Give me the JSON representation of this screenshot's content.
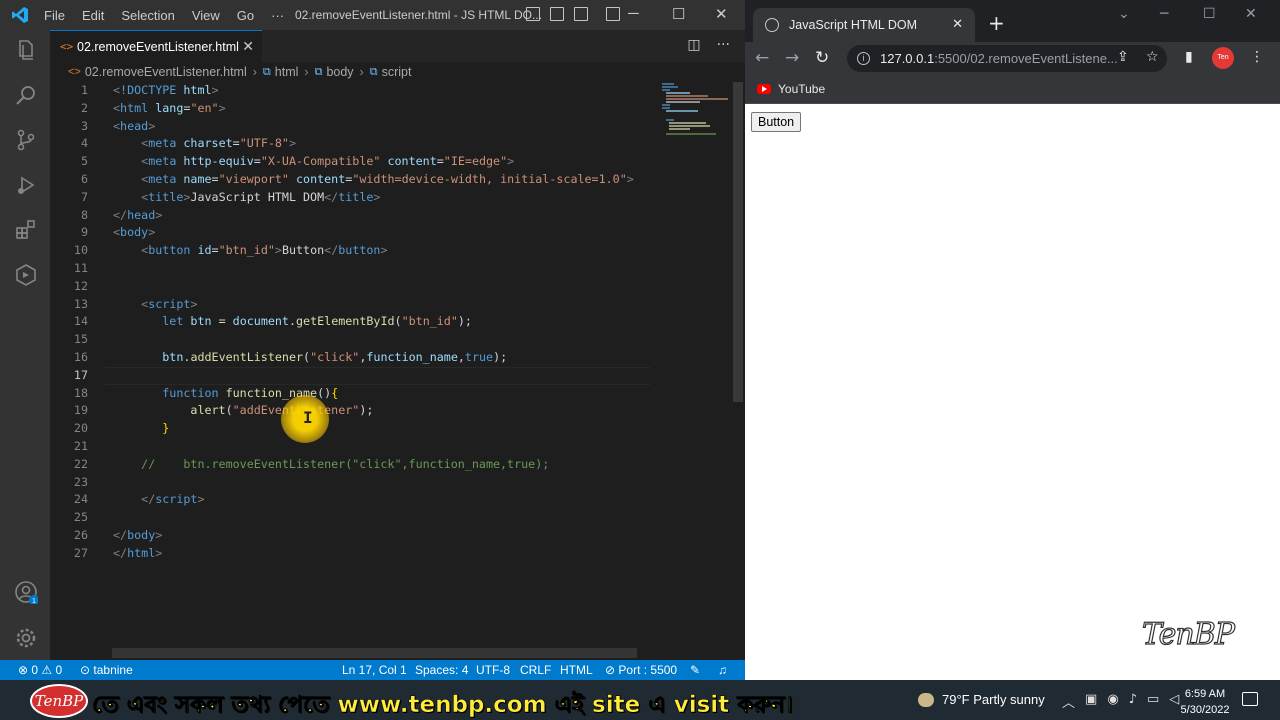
{
  "vscode": {
    "menu": [
      "File",
      "Edit",
      "Selection",
      "View",
      "Go",
      "···"
    ],
    "window_title": "02.removeEventListener.html - JS HTML DO...",
    "tab_label": "02.removeEventListener.html",
    "breadcrumb": [
      "02.removeEventListener.html",
      "html",
      "body",
      "script"
    ],
    "active_line": 17,
    "status": {
      "problems": "⊗ 0 ⚠ 0",
      "tabnine": "tabnine",
      "position": "Ln 17, Col 1",
      "spaces": "Spaces: 4",
      "encoding": "UTF-8",
      "eol": "CRLF",
      "language": "HTML",
      "port": "⊘ Port : 5500"
    },
    "accent": "#007acc"
  },
  "code_lines": [
    {
      "n": "1",
      "indent": "",
      "parts": [
        {
          "c": "t-br",
          "t": "<"
        },
        {
          "c": "t-tag",
          "t": "!DOCTYPE "
        },
        {
          "c": "t-attr",
          "t": "html"
        },
        {
          "c": "t-br",
          "t": ">"
        }
      ]
    },
    {
      "n": "2",
      "indent": "",
      "parts": [
        {
          "c": "t-br",
          "t": "<"
        },
        {
          "c": "t-tag",
          "t": "html "
        },
        {
          "c": "t-attr",
          "t": "lang"
        },
        {
          "c": "t-txt",
          "t": "="
        },
        {
          "c": "t-str",
          "t": "\"en\""
        },
        {
          "c": "t-br",
          "t": ">"
        }
      ]
    },
    {
      "n": "3",
      "indent": "",
      "parts": [
        {
          "c": "t-br",
          "t": "<"
        },
        {
          "c": "t-tag",
          "t": "head"
        },
        {
          "c": "t-br",
          "t": ">"
        }
      ]
    },
    {
      "n": "4",
      "indent": "    ",
      "parts": [
        {
          "c": "t-br",
          "t": "<"
        },
        {
          "c": "t-tag",
          "t": "meta "
        },
        {
          "c": "t-attr",
          "t": "charset"
        },
        {
          "c": "t-txt",
          "t": "="
        },
        {
          "c": "t-str",
          "t": "\"UTF-8\""
        },
        {
          "c": "t-br",
          "t": ">"
        }
      ]
    },
    {
      "n": "5",
      "indent": "    ",
      "parts": [
        {
          "c": "t-br",
          "t": "<"
        },
        {
          "c": "t-tag",
          "t": "meta "
        },
        {
          "c": "t-attr",
          "t": "http-equiv"
        },
        {
          "c": "t-txt",
          "t": "="
        },
        {
          "c": "t-str",
          "t": "\"X-UA-Compatible\" "
        },
        {
          "c": "t-attr",
          "t": "content"
        },
        {
          "c": "t-txt",
          "t": "="
        },
        {
          "c": "t-str",
          "t": "\"IE=edge\""
        },
        {
          "c": "t-br",
          "t": ">"
        }
      ]
    },
    {
      "n": "6",
      "indent": "    ",
      "parts": [
        {
          "c": "t-br",
          "t": "<"
        },
        {
          "c": "t-tag",
          "t": "meta "
        },
        {
          "c": "t-attr",
          "t": "name"
        },
        {
          "c": "t-txt",
          "t": "="
        },
        {
          "c": "t-str",
          "t": "\"viewport\" "
        },
        {
          "c": "t-attr",
          "t": "content"
        },
        {
          "c": "t-txt",
          "t": "="
        },
        {
          "c": "t-str",
          "t": "\"width=device-width, initial-scale=1.0\""
        },
        {
          "c": "t-br",
          "t": ">"
        }
      ]
    },
    {
      "n": "7",
      "indent": "    ",
      "parts": [
        {
          "c": "t-br",
          "t": "<"
        },
        {
          "c": "t-tag",
          "t": "title"
        },
        {
          "c": "t-br",
          "t": ">"
        },
        {
          "c": "t-txt",
          "t": "JavaScript HTML DOM"
        },
        {
          "c": "t-br",
          "t": "</"
        },
        {
          "c": "t-tag",
          "t": "title"
        },
        {
          "c": "t-br",
          "t": ">"
        }
      ]
    },
    {
      "n": "8",
      "indent": "",
      "parts": [
        {
          "c": "t-br",
          "t": "</"
        },
        {
          "c": "t-tag",
          "t": "head"
        },
        {
          "c": "t-br",
          "t": ">"
        }
      ]
    },
    {
      "n": "9",
      "indent": "",
      "parts": [
        {
          "c": "t-br",
          "t": "<"
        },
        {
          "c": "t-tag",
          "t": "body"
        },
        {
          "c": "t-br",
          "t": ">"
        }
      ]
    },
    {
      "n": "10",
      "indent": "    ",
      "parts": [
        {
          "c": "t-br",
          "t": "<"
        },
        {
          "c": "t-tag",
          "t": "button "
        },
        {
          "c": "t-attr",
          "t": "id"
        },
        {
          "c": "t-txt",
          "t": "="
        },
        {
          "c": "t-str",
          "t": "\"btn_id\""
        },
        {
          "c": "t-br",
          "t": ">"
        },
        {
          "c": "t-txt",
          "t": "Button"
        },
        {
          "c": "t-br",
          "t": "</"
        },
        {
          "c": "t-tag",
          "t": "button"
        },
        {
          "c": "t-br",
          "t": ">"
        }
      ]
    },
    {
      "n": "11",
      "indent": "",
      "parts": []
    },
    {
      "n": "12",
      "indent": "",
      "parts": []
    },
    {
      "n": "13",
      "indent": "    ",
      "parts": [
        {
          "c": "t-br",
          "t": "<"
        },
        {
          "c": "t-tag",
          "t": "script"
        },
        {
          "c": "t-br",
          "t": ">"
        }
      ]
    },
    {
      "n": "14",
      "indent": "       ",
      "parts": [
        {
          "c": "t-kw",
          "t": "let "
        },
        {
          "c": "t-var",
          "t": "btn"
        },
        {
          "c": "t-txt",
          "t": " = "
        },
        {
          "c": "t-var",
          "t": "document"
        },
        {
          "c": "t-txt",
          "t": "."
        },
        {
          "c": "t-fn",
          "t": "getElementById"
        },
        {
          "c": "t-txt",
          "t": "("
        },
        {
          "c": "t-str",
          "t": "\"btn_id\""
        },
        {
          "c": "t-txt",
          "t": ");"
        }
      ]
    },
    {
      "n": "15",
      "indent": "",
      "parts": []
    },
    {
      "n": "16",
      "indent": "       ",
      "parts": [
        {
          "c": "t-var",
          "t": "btn"
        },
        {
          "c": "t-txt",
          "t": "."
        },
        {
          "c": "t-fn",
          "t": "addEventListener"
        },
        {
          "c": "t-txt",
          "t": "("
        },
        {
          "c": "t-str",
          "t": "\"click\""
        },
        {
          "c": "t-txt",
          "t": ","
        },
        {
          "c": "t-var",
          "t": "function_name"
        },
        {
          "c": "t-txt",
          "t": ","
        },
        {
          "c": "t-kw",
          "t": "true"
        },
        {
          "c": "t-txt",
          "t": ");"
        }
      ]
    },
    {
      "n": "17",
      "indent": "",
      "parts": []
    },
    {
      "n": "18",
      "indent": "       ",
      "parts": [
        {
          "c": "t-kw",
          "t": "function "
        },
        {
          "c": "t-fn",
          "t": "function_name"
        },
        {
          "c": "t-txt",
          "t": "()"
        },
        {
          "c": "t-brk",
          "t": "{"
        }
      ]
    },
    {
      "n": "19",
      "indent": "           ",
      "parts": [
        {
          "c": "t-fn",
          "t": "alert"
        },
        {
          "c": "t-txt",
          "t": "("
        },
        {
          "c": "t-str",
          "t": "\"addEventListener\""
        },
        {
          "c": "t-txt",
          "t": ");"
        }
      ]
    },
    {
      "n": "20",
      "indent": "       ",
      "parts": [
        {
          "c": "t-brk",
          "t": "}"
        }
      ]
    },
    {
      "n": "21",
      "indent": "",
      "parts": []
    },
    {
      "n": "22",
      "indent": "    ",
      "parts": [
        {
          "c": "t-cm",
          "t": "//    btn.removeEventListener(\"click\",function_name,true);"
        }
      ]
    },
    {
      "n": "23",
      "indent": "",
      "parts": []
    },
    {
      "n": "24",
      "indent": "    ",
      "parts": [
        {
          "c": "t-br",
          "t": "</"
        },
        {
          "c": "t-tag",
          "t": "script"
        },
        {
          "c": "t-br",
          "t": ">"
        }
      ]
    },
    {
      "n": "25",
      "indent": "",
      "parts": []
    },
    {
      "n": "26",
      "indent": "",
      "parts": [
        {
          "c": "t-br",
          "t": "</"
        },
        {
          "c": "t-tag",
          "t": "body"
        },
        {
          "c": "t-br",
          "t": ">"
        }
      ]
    },
    {
      "n": "27",
      "indent": "",
      "parts": [
        {
          "c": "t-br",
          "t": "</"
        },
        {
          "c": "t-tag",
          "t": "html"
        },
        {
          "c": "t-br",
          "t": ">"
        }
      ]
    }
  ],
  "browser": {
    "tab_title": "JavaScript HTML DOM",
    "url_host": "127.0.0.1",
    "url_path": ":5500/02.removeEventListene...",
    "bookmark": "YouTube",
    "page_button": "Button",
    "watermark": "TenBP",
    "avatar_text": "Ten BP"
  },
  "taskbar": {
    "logo_text": "TenBP",
    "banner": "তে এবং সকল তথ্য পেতে www.tenbp.com এই site এ  visit করুন।",
    "weather": "79°F  Partly sunny",
    "time": "6:59 AM",
    "date": "5/30/2022"
  }
}
